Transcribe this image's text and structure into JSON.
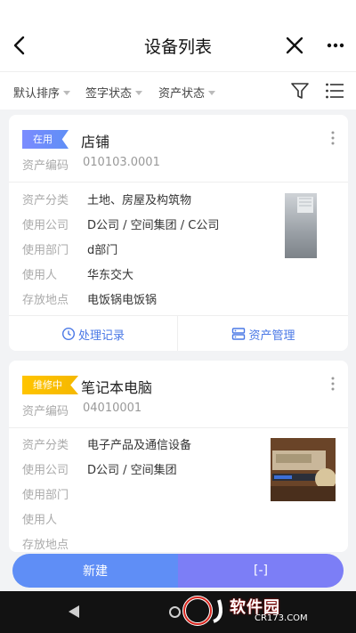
{
  "header": {
    "title": "设备列表"
  },
  "filters": {
    "sort": "默认排序",
    "sign_status": "签字状态",
    "asset_status": "资产状态"
  },
  "labels": {
    "asset_code": "资产编码",
    "category": "资产分类",
    "company": "使用公司",
    "department": "使用部门",
    "user": "使用人",
    "location": "存放地点"
  },
  "cards": [
    {
      "status": "在用",
      "status_color": "#6b8ef8",
      "name": "店铺",
      "asset_code": "010103.0001",
      "category": "土地、房屋及构筑物",
      "company": "D公司 / 空间集团 / C公司",
      "department": "d部门",
      "user": "华东交大",
      "location": "电饭锅电饭锅",
      "actions": {
        "records": "处理记录",
        "manage": "资产管理"
      }
    },
    {
      "status": "维修中",
      "status_color": "#f7b900",
      "name": "笔记本电脑",
      "asset_code": "04010001",
      "category": "电子产品及通信设备",
      "company": "D公司 / 空间集团",
      "department": "",
      "user": "",
      "location": ""
    }
  ],
  "bottom": {
    "new_label": "新建",
    "scan_label": "[-]"
  },
  "watermark": {
    "brand": "软件园",
    "url": "CR173.COM"
  },
  "colors": {
    "accent": "#5f8ef6",
    "accent2": "#7c7ef6",
    "text_muted": "#aaaaaa"
  }
}
